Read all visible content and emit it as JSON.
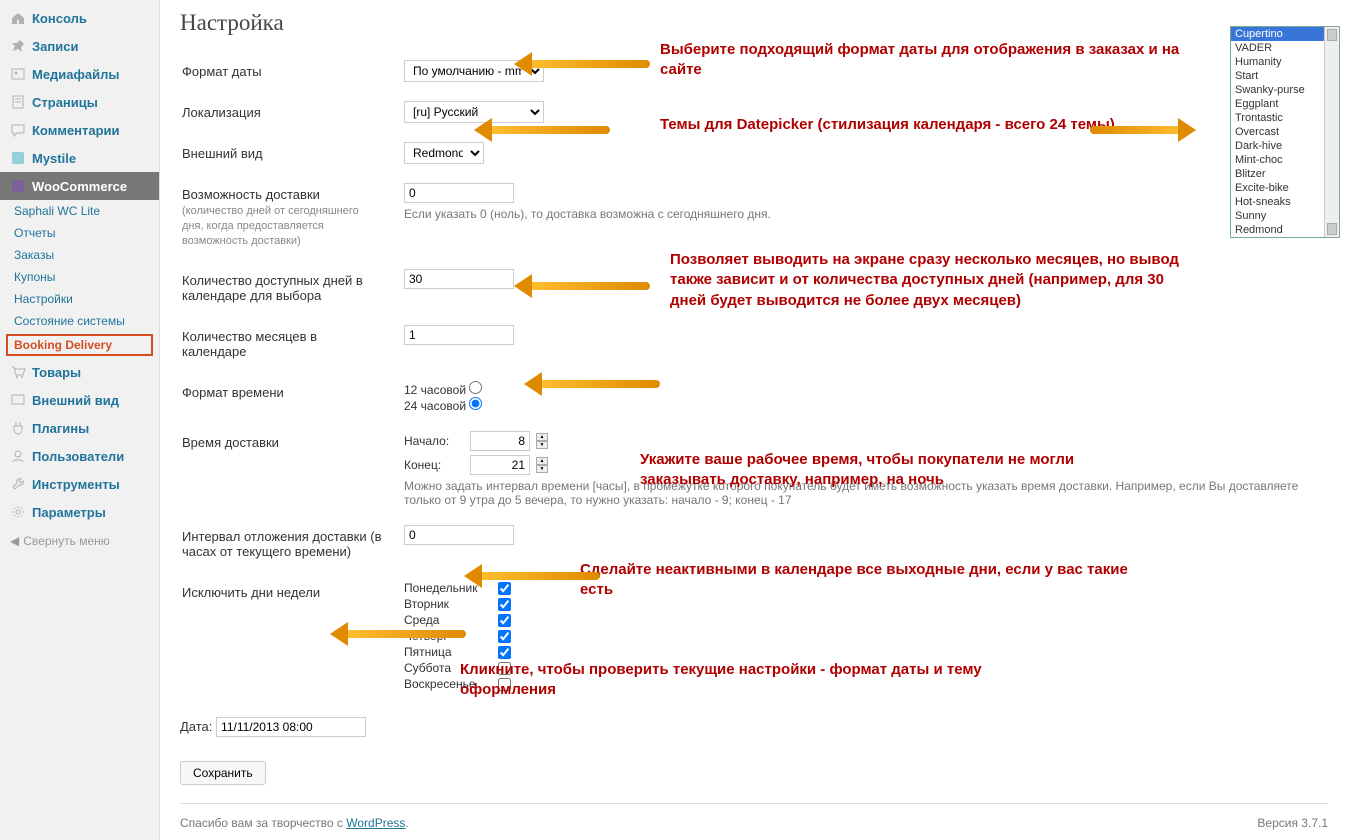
{
  "sidebar": {
    "items": [
      {
        "label": "Консоль",
        "icon": "home"
      },
      {
        "label": "Записи",
        "icon": "pin"
      },
      {
        "label": "Медиафайлы",
        "icon": "media"
      },
      {
        "label": "Страницы",
        "icon": "page"
      },
      {
        "label": "Комментарии",
        "icon": "comment"
      },
      {
        "label": "Mystile",
        "icon": "theme"
      },
      {
        "label": "WooCommerce",
        "icon": "woo",
        "active": true
      }
    ],
    "sub": [
      "Saphali WC Lite",
      "Отчеты",
      "Заказы",
      "Купоны",
      "Настройки",
      "Состояние системы"
    ],
    "current": "Booking Delivery",
    "after": [
      {
        "label": "Товары",
        "icon": "cart"
      },
      {
        "label": "Внешний вид",
        "icon": "appearance"
      },
      {
        "label": "Плагины",
        "icon": "plugin"
      },
      {
        "label": "Пользователи",
        "icon": "users"
      },
      {
        "label": "Инструменты",
        "icon": "tools"
      },
      {
        "label": "Параметры",
        "icon": "settings"
      }
    ],
    "collapse": "Свернуть меню"
  },
  "page": {
    "title": "Настройка",
    "fields": {
      "date_format": {
        "label": "Формат даты",
        "value": "По умолчанию - mm/dd/yy"
      },
      "locale": {
        "label": "Локализация",
        "value": "[ru] Русский"
      },
      "theme": {
        "label": "Внешний вид",
        "value": "Redmond"
      },
      "offset": {
        "label": "Возможность доставки",
        "sub": "(количество дней от сегодняшнего дня, когда предоставляется возможность доставки)",
        "value": "0",
        "hint": "Если указать 0 (ноль), то доставка возможна с сегодняшнего дня."
      },
      "days_count": {
        "label": "Количество доступных дней в календаре для выбора",
        "value": "30"
      },
      "months": {
        "label": "Количество месяцев в календаре",
        "value": "1"
      },
      "time_format": {
        "label": "Формат времени",
        "opt1": "12 часовой",
        "opt2": "24 часовой"
      },
      "delivery_time": {
        "label": "Время доставки",
        "start_label": "Начало:",
        "start": "8",
        "end_label": "Конец:",
        "end": "21",
        "hint": "Можно задать интервал времени [часы], в промежутке которого покупатель будет иметь возможность указать время доставки. Например, если Вы доставляете только от 9 утра до 5 вечера, то нужно указать: начало - 9; конец - 17"
      },
      "delay": {
        "label": "Интервал отложения доставки (в часах от текущего времени)",
        "value": "0"
      },
      "exclude": {
        "label": "Исключить дни недели",
        "days": [
          "Понедельник",
          "Вторник",
          "Среда",
          "Четверг",
          "Пятница",
          "Суббота",
          "Воскресенье"
        ],
        "checked": [
          true,
          true,
          true,
          true,
          true,
          false,
          false
        ]
      }
    },
    "preview": {
      "label": "Дата:",
      "value": "11/11/2013 08:00"
    },
    "save": "Сохранить",
    "footer_text": "Спасибо вам за творчество с ",
    "footer_link": "WordPress",
    "version": "Версия 3.7.1"
  },
  "themes": [
    "Cupertino",
    "VADER",
    "Humanity",
    "Start",
    "Swanky-purse",
    "Eggplant",
    "Trontastic",
    "Overcast",
    "Dark-hive",
    "Mint-choc",
    "Blitzer",
    "Excite-bike",
    "Hot-sneaks",
    "Sunny",
    "Redmond"
  ],
  "annotations": {
    "a1": "Выберите подходящий формат даты для отображения в заказах и на сайте",
    "a2": "Темы для Datepicker (стилизация календаря - всего 24 темы)",
    "a3": "Позволяет выводить на экране сразу несколько месяцев, но вывод также зависит и от количества доступных дней (например, для 30 дней будет выводится не более двух месяцев)",
    "a4": "Укажите ваше рабочее время, чтобы покупатели не могли заказывать доставку, например, на ночь",
    "a5": "Сделайте неактивными в календаре все выходные дни, если у вас такие есть",
    "a6": "Кликните, чтобы проверить текущие настройки - формат даты и тему оформления"
  }
}
